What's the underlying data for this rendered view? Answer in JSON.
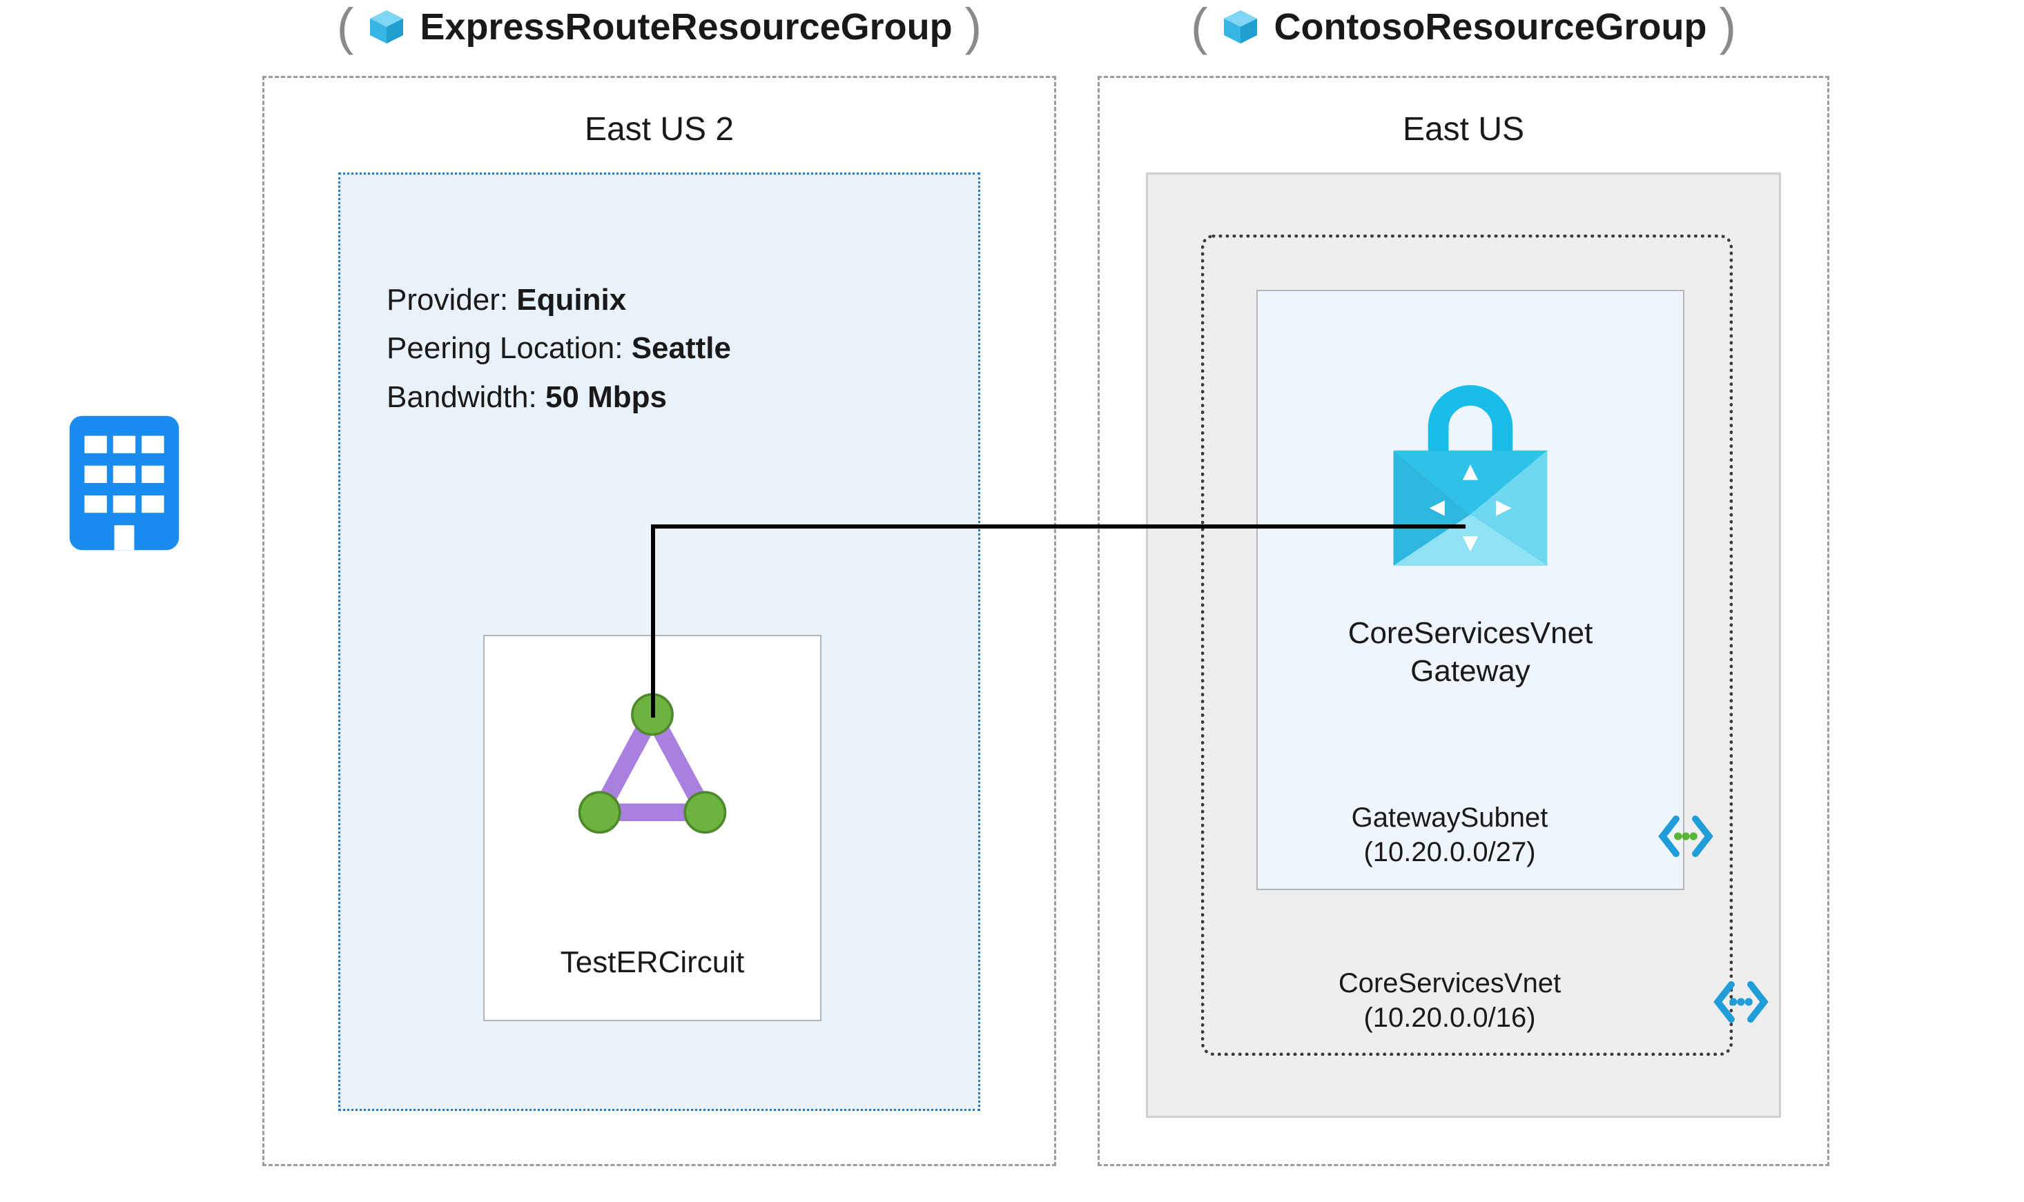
{
  "left_rg": {
    "title": "ExpressRouteResourceGroup",
    "region": "East US 2",
    "provider_key": "Provider: ",
    "provider_val": "Equinix",
    "peering_key": "Peering Location: ",
    "peering_val": "Seattle",
    "bw_key": "Bandwidth: ",
    "bw_val": "50 Mbps",
    "circuit_name": "TestERCircuit"
  },
  "right_rg": {
    "title": "ContosoResourceGroup",
    "region": "East US",
    "gateway_name_l1": "CoreServicesVnet",
    "gateway_name_l2": "Gateway",
    "subnet_name": "GatewaySubnet",
    "subnet_cidr": "(10.20.0.0/27)",
    "vnet_name": "CoreServicesVnet",
    "vnet_cidr": "(10.20.0.0/16)"
  }
}
